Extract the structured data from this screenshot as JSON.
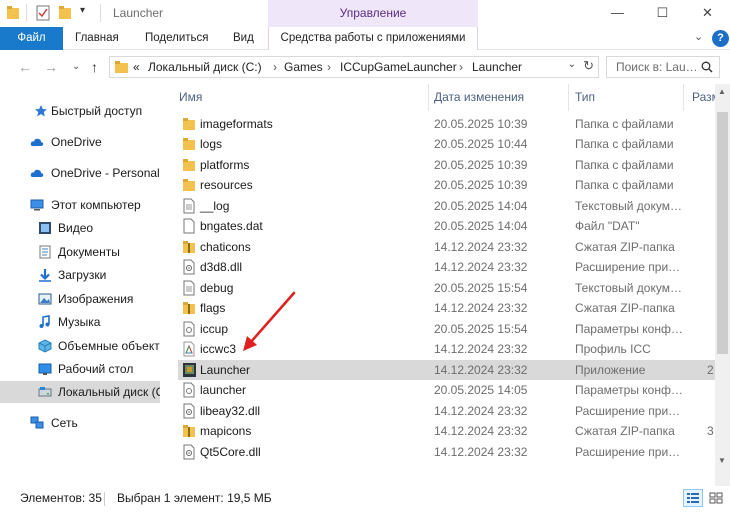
{
  "window": {
    "title": "Launcher",
    "manage_tab": "Управление",
    "minimize": "—",
    "maximize": "☐",
    "close": "✕"
  },
  "ribbon": {
    "tabs": [
      {
        "label": "Файл"
      },
      {
        "label": "Главная"
      },
      {
        "label": "Поделиться"
      },
      {
        "label": "Вид"
      },
      {
        "label": "Средства работы с приложениями"
      }
    ],
    "help_label": "?",
    "expand_glyph": "⌄"
  },
  "address": {
    "overflow": "«",
    "crumbs": [
      "Локальный диск (C:)",
      "Games",
      "ICCupGameLauncher",
      "Launcher"
    ],
    "separator": "›",
    "dropdown_glyph": "⌄",
    "refresh_glyph": "↻"
  },
  "search": {
    "placeholder": "Поиск в: Lau…"
  },
  "nav": {
    "back": "←",
    "forward": "→",
    "recent": "⌄",
    "up": "↑",
    "items": [
      {
        "label": "Быстрый доступ",
        "icon": "star-icon"
      },
      {
        "label": "OneDrive",
        "icon": "cloud-icon"
      },
      {
        "label": "OneDrive - Personal",
        "icon": "cloud-icon"
      },
      {
        "label": "Этот компьютер",
        "icon": "computer-icon"
      },
      {
        "label": "Видео",
        "icon": "video-icon"
      },
      {
        "label": "Документы",
        "icon": "documents-icon"
      },
      {
        "label": "Загрузки",
        "icon": "download-icon"
      },
      {
        "label": "Изображения",
        "icon": "pictures-icon"
      },
      {
        "label": "Музыка",
        "icon": "music-icon"
      },
      {
        "label": "Объемные объекты",
        "icon": "3d-objects-icon"
      },
      {
        "label": "Рабочий стол",
        "icon": "desktop-icon"
      },
      {
        "label": "Локальный диск (C:)",
        "icon": "drive-icon"
      },
      {
        "label": "Сеть",
        "icon": "network-icon"
      }
    ]
  },
  "columns": {
    "name": "Имя",
    "date": "Дата изменения",
    "type": "Тип",
    "size": "Разм"
  },
  "files": [
    {
      "name": "imageformats",
      "date": "20.05.2025 10:39",
      "type": "Папка с файлами",
      "size": "",
      "icon": "folder-icon"
    },
    {
      "name": "logs",
      "date": "20.05.2025 10:44",
      "type": "Папка с файлами",
      "size": "",
      "icon": "folder-icon"
    },
    {
      "name": "platforms",
      "date": "20.05.2025 10:39",
      "type": "Папка с файлами",
      "size": "",
      "icon": "folder-icon"
    },
    {
      "name": "resources",
      "date": "20.05.2025 10:39",
      "type": "Папка с файлами",
      "size": "",
      "icon": "folder-icon"
    },
    {
      "name": "__log",
      "date": "20.05.2025 14:04",
      "type": "Текстовый докум…",
      "size": "",
      "icon": "text-file-icon"
    },
    {
      "name": "bngates.dat",
      "date": "20.05.2025 14:04",
      "type": "Файл \"DAT\"",
      "size": "",
      "icon": "file-icon"
    },
    {
      "name": "chaticons",
      "date": "14.12.2024 23:32",
      "type": "Сжатая ZIP-папка",
      "size": "",
      "icon": "zip-icon"
    },
    {
      "name": "d3d8.dll",
      "date": "14.12.2024 23:32",
      "type": "Расширение при…",
      "size": "",
      "icon": "dll-icon"
    },
    {
      "name": "debug",
      "date": "20.05.2025 15:54",
      "type": "Текстовый докум…",
      "size": "",
      "icon": "text-file-icon"
    },
    {
      "name": "flags",
      "date": "14.12.2024 23:32",
      "type": "Сжатая ZIP-папка",
      "size": "",
      "icon": "zip-icon"
    },
    {
      "name": "iccup",
      "date": "20.05.2025 15:54",
      "type": "Параметры конф…",
      "size": "",
      "icon": "config-icon"
    },
    {
      "name": "iccwc3",
      "date": "14.12.2024 23:32",
      "type": "Профиль ICC",
      "size": "",
      "icon": "icc-profile-icon"
    },
    {
      "name": "Launcher",
      "date": "14.12.2024 23:32",
      "type": "Приложение",
      "size": "2",
      "icon": "app-icon",
      "selected": true
    },
    {
      "name": "launcher",
      "date": "20.05.2025 14:05",
      "type": "Параметры конф…",
      "size": "",
      "icon": "config-icon"
    },
    {
      "name": "libeay32.dll",
      "date": "14.12.2024 23:32",
      "type": "Расширение при…",
      "size": "",
      "icon": "dll-icon"
    },
    {
      "name": "mapicons",
      "date": "14.12.2024 23:32",
      "type": "Сжатая ZIP-папка",
      "size": "3",
      "icon": "zip-icon"
    },
    {
      "name": "Qt5Core.dll",
      "date": "14.12.2024 23:32",
      "type": "Расширение при…",
      "size": "",
      "icon": "dll-icon"
    }
  ],
  "status": {
    "count": "Элементов: 35",
    "selection": "Выбран 1 элемент: 19,5 МБ"
  },
  "colors": {
    "accent": "#1979ca",
    "manage_tab_bg": "#f0e6fa",
    "manage_tab_text": "#5a2d82",
    "selection_bg": "#d9d9d9",
    "folder": "#f2c14e",
    "annotation_arrow": "#e02020"
  }
}
